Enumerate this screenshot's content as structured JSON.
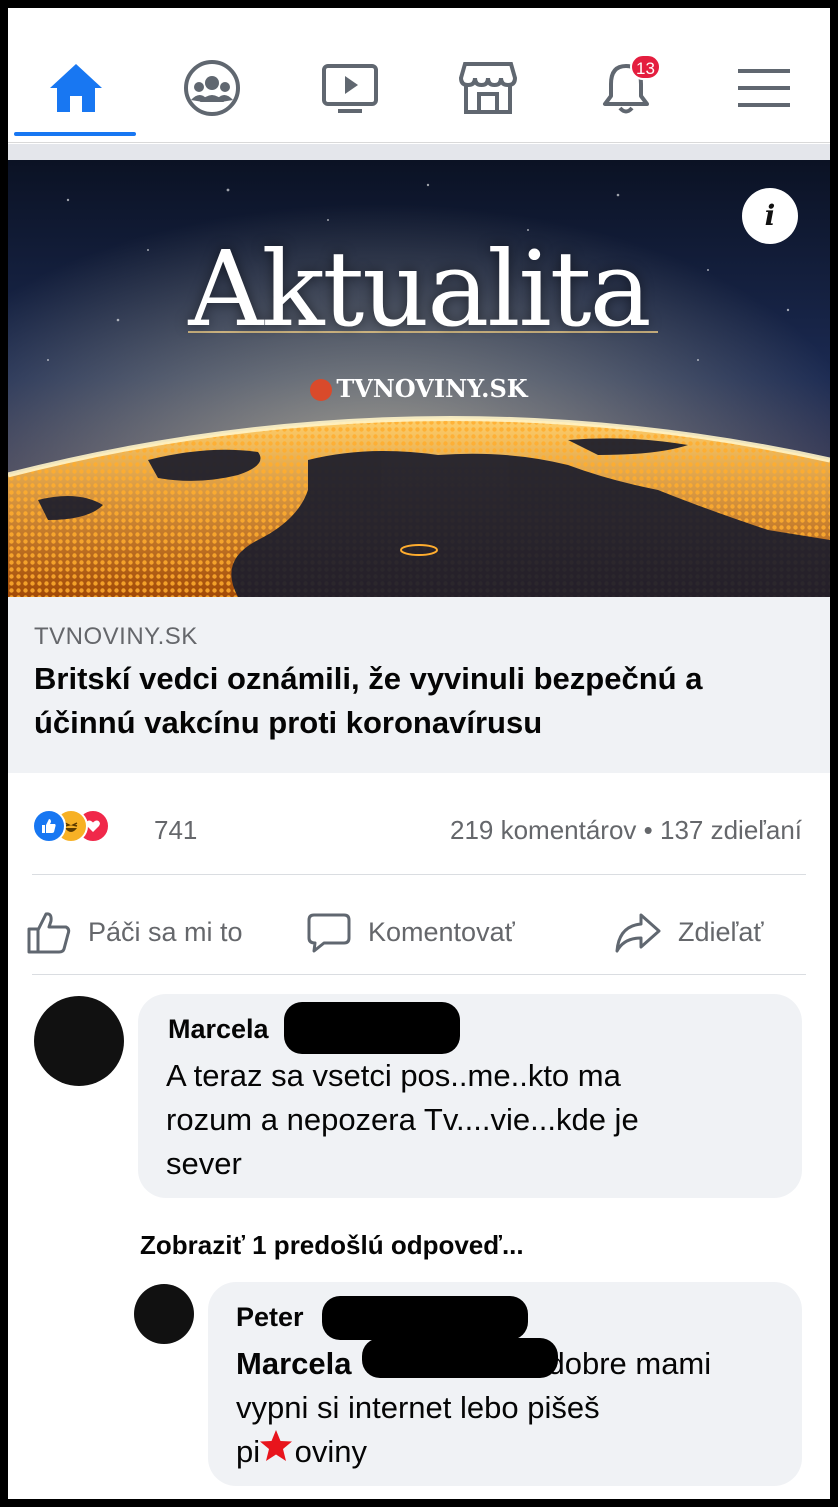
{
  "nav": {
    "items": [
      {
        "name": "home-icon",
        "active": true
      },
      {
        "name": "groups-icon"
      },
      {
        "name": "watch-icon"
      },
      {
        "name": "marketplace-icon"
      },
      {
        "name": "bell-icon"
      },
      {
        "name": "menu-icon"
      }
    ],
    "notification_badge": "13",
    "accent": "#1877f2"
  },
  "post": {
    "hero": {
      "title": "Aktualita",
      "brand": "TVNOVINY.SK",
      "info_label": "i"
    },
    "link": {
      "source": "TVNOVINY.SK",
      "title": "Britskí vedci oznámili, že vyvinuli bezpečnú a účinnú vakcínu proti koronavírusu"
    },
    "reactions": {
      "icons": [
        "like-icon",
        "haha-icon",
        "love-icon"
      ],
      "count": "741"
    },
    "stats": "219 komentárov • 137 zdieľaní",
    "actions": {
      "like": "Páči sa mi to",
      "comment": "Komentovať",
      "share": "Zdieľať"
    }
  },
  "comments": [
    {
      "name": "Marcela",
      "text_lines": [
        "A teraz sa vsetci pos..me..kto ma",
        "rozum a nepozera Tv....vie...kde je",
        "sever"
      ]
    }
  ],
  "previous_replies_label": "Zobraziť 1 predošlú odpoveď...",
  "reply": {
    "name": "Peter",
    "mention": "Marcela",
    "text_line1": "dobre mami",
    "text_line2": "vypni si internet lebo pišeš",
    "text_line3": "pi    oviny"
  }
}
